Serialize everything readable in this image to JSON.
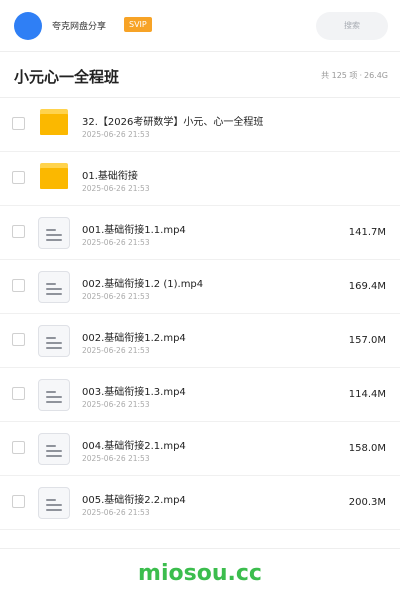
{
  "header": {
    "owner_name": "夸克网盘分享",
    "badge": "SVIP",
    "search_placeholder": "搜索"
  },
  "folder": {
    "title": "小元心一全程班",
    "count_text": "共 125 项",
    "separator": "·",
    "total_size": "26.4G"
  },
  "items": [
    {
      "name": "32.【2026考研数学】小元、心一全程班",
      "date": "2025-06-26 21:53",
      "size": "",
      "type": "folder"
    },
    {
      "name": "01.基础衔接",
      "date": "2025-06-26 21:53",
      "size": "",
      "type": "folder"
    },
    {
      "name": "001.基础衔接1.1.mp4",
      "date": "2025-06-26 21:53",
      "size": "141.7M",
      "type": "file"
    },
    {
      "name": "002.基础衔接1.2 (1).mp4",
      "date": "2025-06-26 21:53",
      "size": "169.4M",
      "type": "file"
    },
    {
      "name": "002.基础衔接1.2.mp4",
      "date": "2025-06-26 21:53",
      "size": "157.0M",
      "type": "file"
    },
    {
      "name": "003.基础衔接1.3.mp4",
      "date": "2025-06-26 21:53",
      "size": "114.4M",
      "type": "file"
    },
    {
      "name": "004.基础衔接2.1.mp4",
      "date": "2025-06-26 21:53",
      "size": "158.0M",
      "type": "file"
    },
    {
      "name": "005.基础衔接2.2.mp4",
      "date": "2025-06-26 21:53",
      "size": "200.3M",
      "type": "file"
    }
  ],
  "footer": {
    "brand": "miosou.cc"
  },
  "colors": {
    "avatar": "#2f7ff5",
    "badge": "#f7a326",
    "folder": "#fbb800",
    "brand": "#3bbd4d"
  }
}
